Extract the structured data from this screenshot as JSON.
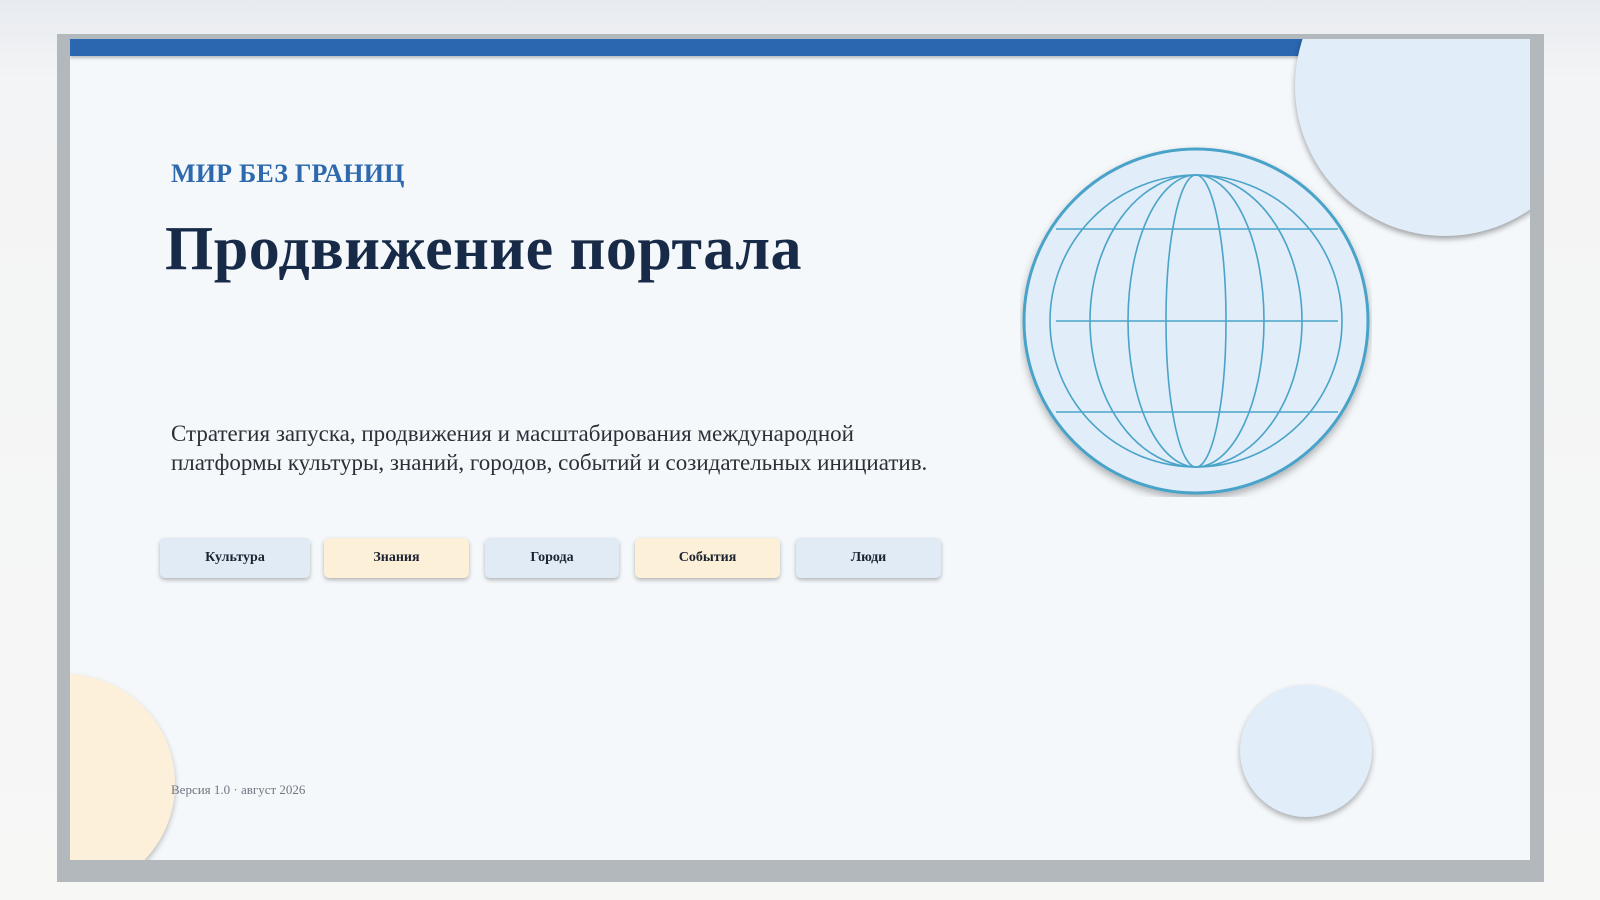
{
  "slide": {
    "kicker": "МИР БЕЗ ГРАНИЦ",
    "title": "Продвижение портала",
    "lead": "Стратегия запуска, продвижения и масштабирования международной платформы культуры, знаний, городов, событий и созидательных инициатив.",
    "tags": [
      {
        "label": "Культура",
        "tone": "blue"
      },
      {
        "label": "Знания",
        "tone": "cream"
      },
      {
        "label": "Города",
        "tone": "blue"
      },
      {
        "label": "События",
        "tone": "cream"
      },
      {
        "label": "Люди",
        "tone": "blue"
      }
    ],
    "version": "Версия 1.0 · август 2026",
    "globe_icon": "globe-icon"
  },
  "colors": {
    "accent_blue": "#2b67b1",
    "title_navy": "#172a47",
    "globe_stroke": "#4aa3c9",
    "light_blue": "#e1edf8",
    "cream": "#fcf0db",
    "frame_gray": "#b3b8bc"
  }
}
